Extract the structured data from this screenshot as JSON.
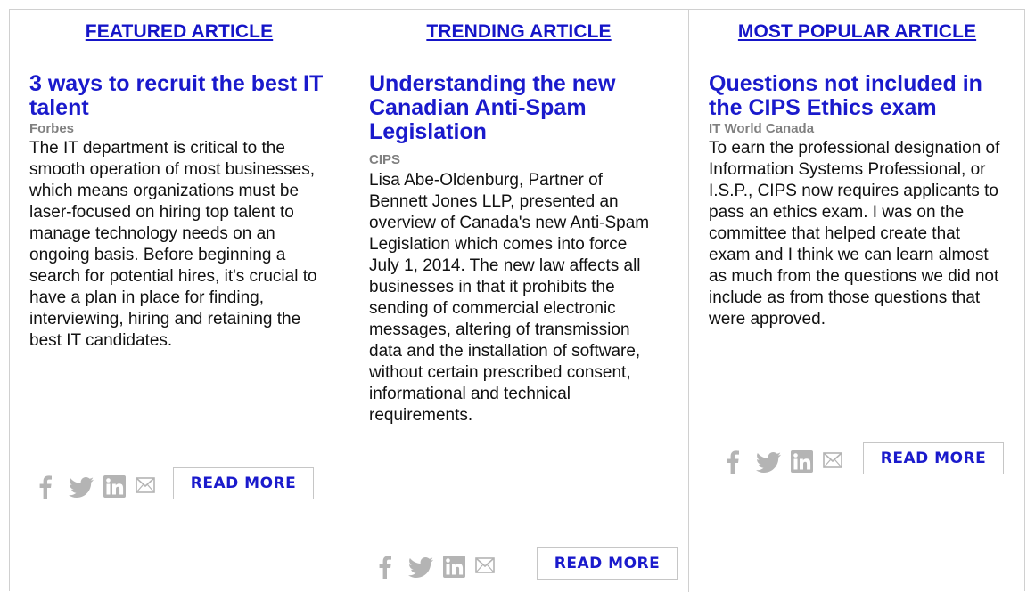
{
  "columns": [
    {
      "header": "FEATURED ARTICLE",
      "title": "3 ways to recruit the best IT talent",
      "source": "Forbes",
      "body": "The IT department is critical to the smooth operation of most businesses, which means organizations must be laser-focused on hiring top talent to manage technology needs on an ongoing basis. Before beginning a search for potential hires, it's crucial to have a plan in place for finding, interviewing, hiring and retaining the best IT candidates.",
      "read_more": "READ MORE"
    },
    {
      "header": "TRENDING ARTICLE",
      "title": "Understanding the new Canadian Anti-Spam Legislation",
      "source": "CIPS",
      "body": "Lisa Abe-Oldenburg, Partner of Bennett Jones LLP, presented an overview of Canada's new Anti-Spam Legislation which comes into force July 1, 2014. The new law affects all businesses in that it prohibits the sending of commercial electronic messages, altering of transmission data and the installation of software, without certain prescribed consent, informational and technical requirements.",
      "read_more": "READ MORE"
    },
    {
      "header": "MOST POPULAR ARTICLE",
      "title": "Questions not included in the CIPS Ethics exam",
      "source": "IT World Canada",
      "body": "To earn the professional designation of Information Systems Professional, or I.S.P., CIPS now requires applicants to pass an ethics exam. I was on the committee that helped create that exam and I think we can learn almost as much from the questions we did not include as from those questions that were approved.",
      "read_more": "READ MORE"
    }
  ],
  "share_icons": [
    "facebook-icon",
    "twitter-icon",
    "linkedin-icon",
    "email-icon"
  ],
  "colors": {
    "link": "#1a1acc",
    "source": "#808080",
    "icon": "#b4b4b4",
    "border": "#d0d0d0"
  }
}
